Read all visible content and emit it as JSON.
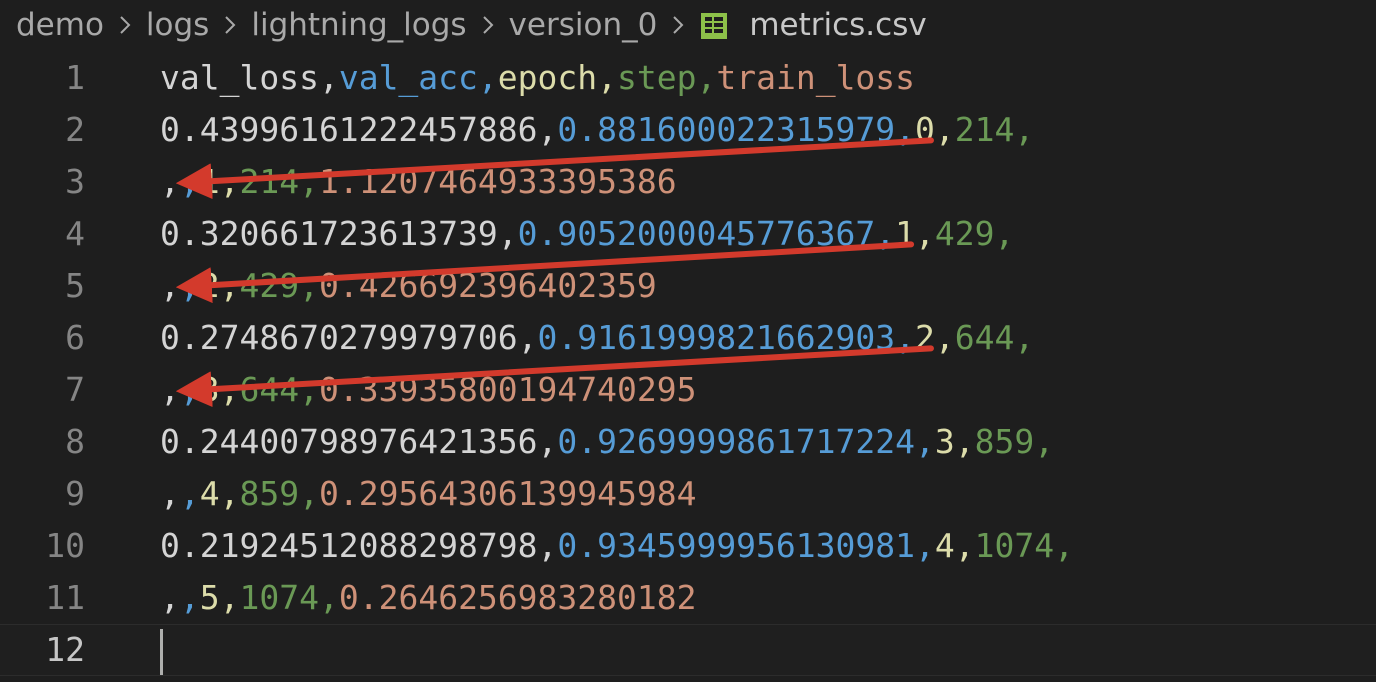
{
  "breadcrumb": {
    "items": [
      "demo",
      "logs",
      "lightning_logs",
      "version_0"
    ],
    "file": "metrics.csv",
    "file_icon": "spreadsheet-icon"
  },
  "colors": {
    "col0": "#d4d4d4",
    "col1": "#569cd6",
    "col2": "#dcdcaa",
    "col3": "#6a9955",
    "col4": "#ce9178",
    "arrow": "#d33a2c"
  },
  "editor": {
    "lines": [
      {
        "number": "1",
        "fields": [
          "val_loss",
          "val_acc",
          "epoch",
          "step",
          "train_loss"
        ]
      },
      {
        "number": "2",
        "fields": [
          "0.43996161222457886",
          "0.881600022315979",
          "0",
          "214",
          ""
        ]
      },
      {
        "number": "3",
        "fields": [
          "",
          "",
          "1",
          "214",
          "1.1207464933395386"
        ]
      },
      {
        "number": "4",
        "fields": [
          "0.320661723613739",
          "0.9052000045776367",
          "1",
          "429",
          ""
        ]
      },
      {
        "number": "5",
        "fields": [
          "",
          "",
          "2",
          "429",
          "0.426692396402359"
        ]
      },
      {
        "number": "6",
        "fields": [
          "0.2748670279979706",
          "0.9161999821662903",
          "2",
          "644",
          ""
        ]
      },
      {
        "number": "7",
        "fields": [
          "",
          "",
          "3",
          "644",
          "0.33935800194740295"
        ]
      },
      {
        "number": "8",
        "fields": [
          "0.24400798976421356",
          "0.9269999861717224",
          "3",
          "859",
          ""
        ]
      },
      {
        "number": "9",
        "fields": [
          "",
          "",
          "4",
          "859",
          "0.29564306139945984"
        ]
      },
      {
        "number": "10",
        "fields": [
          "0.21924512088298798",
          "0.9345999956130981",
          "4",
          "1074",
          ""
        ]
      },
      {
        "number": "11",
        "fields": [
          "",
          "",
          "5",
          "1074",
          "0.2646256983280182"
        ]
      },
      {
        "number": "12",
        "fields": []
      }
    ],
    "active_line": 12
  },
  "annotations": {
    "arrows": [
      {
        "from_line": 2,
        "from_field": "epoch",
        "to_line": 3,
        "to_field": "epoch"
      },
      {
        "from_line": 4,
        "from_field": "epoch",
        "to_line": 5,
        "to_field": "epoch"
      },
      {
        "from_line": 6,
        "from_field": "epoch",
        "to_line": 7,
        "to_field": "epoch"
      }
    ]
  }
}
